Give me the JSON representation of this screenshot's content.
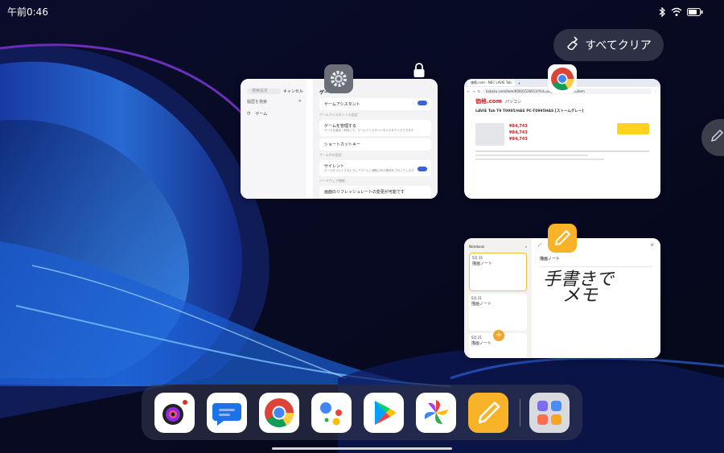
{
  "status_bar": {
    "time": "午前0:46",
    "icons": [
      "bluetooth-icon",
      "wifi-icon",
      "battery-icon"
    ]
  },
  "clear_all": {
    "label": "すべてクリア",
    "icon": "broom-icon"
  },
  "cards": {
    "settings": {
      "app": "settings-icon",
      "search_placeholder": "検索設定",
      "cancel_label": "キャンセル",
      "history_label": "履歴を検索",
      "history_item": "ゲーム",
      "title": "ゲー",
      "rows": [
        {
          "section": "",
          "label": "ゲームアシスタント",
          "sub": "",
          "toggle": true
        },
        {
          "section": "ゲームアシスタントの設定",
          "label": "ゲームを管理する",
          "sub": "ゲームを追加・削除して、ゲームアシスタントをカスタマイズできます",
          "toggle": false
        },
        {
          "section": "",
          "label": "ショートカットキー",
          "sub": "",
          "toggle": false
        },
        {
          "section": "ゲーム中の設定",
          "label": "サイレント",
          "sub": "ゲームをプレイするときにアラームと通知以外の着信をブロックします",
          "toggle": true
        },
        {
          "section": "ハードウェア機能",
          "label": "画面のリフレッシュレートの変更が可能です",
          "sub": "",
          "toggle": false
        }
      ]
    },
    "chrome": {
      "app": "chrome-icon",
      "tab1": "価格.com - NEC LAVIE Tab",
      "url": "kakaku.com/item/K0001526913/?lid=pc_ksearch_kakakuitem",
      "site": "価格.com",
      "category": "パソコン",
      "product_title": "LAVIE Tab T9 T0995/HAS PC-T0995HAS [ストームグレー]",
      "prices": [
        "¥84,743",
        "¥84,743",
        "¥84,743"
      ]
    },
    "notes": {
      "app": "notes-icon",
      "list_title": "Notebook",
      "items": [
        {
          "date": "5月 15",
          "title": "描画ノート"
        },
        {
          "date": "5月 21",
          "title": "描画ノート"
        },
        {
          "date": "5月 21",
          "title": "描画ノート"
        }
      ],
      "editor_title": "描画ノート",
      "handwriting_line1": "手書きで",
      "handwriting_line2": "メモ"
    }
  },
  "dock": {
    "apps": [
      "camera-app-icon",
      "messages-app-icon",
      "chrome-app-icon",
      "assistant-app-icon",
      "play-store-app-icon",
      "pinwheel-app-icon",
      "notes-app-icon",
      "app-drawer-icon"
    ]
  }
}
